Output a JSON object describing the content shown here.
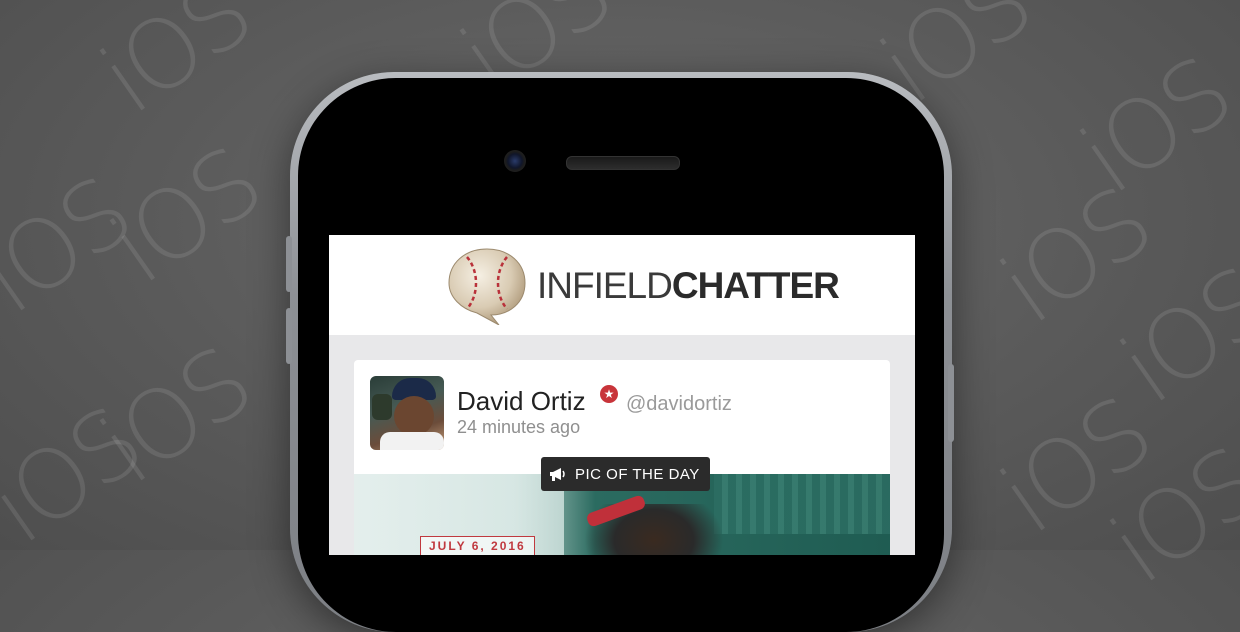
{
  "colors": {
    "background": "#5a5a5a",
    "accent_red": "#c8343a",
    "badge_dark": "#2b2b2b"
  },
  "background_pattern": {
    "glyph": "iOS"
  },
  "app": {
    "logo_icon": "baseball-chat-bubble-icon",
    "logo_text_thin": "INFIELD",
    "logo_text_bold": "CHATTER"
  },
  "post": {
    "user_name": "David Ortiz",
    "verified_icon": "star-badge-icon",
    "handle": "@davidortiz",
    "timestamp": "24 minutes ago",
    "badge_icon": "megaphone-icon",
    "badge_label": "PIC OF THE DAY",
    "date_label": "JULY 6, 2016"
  }
}
